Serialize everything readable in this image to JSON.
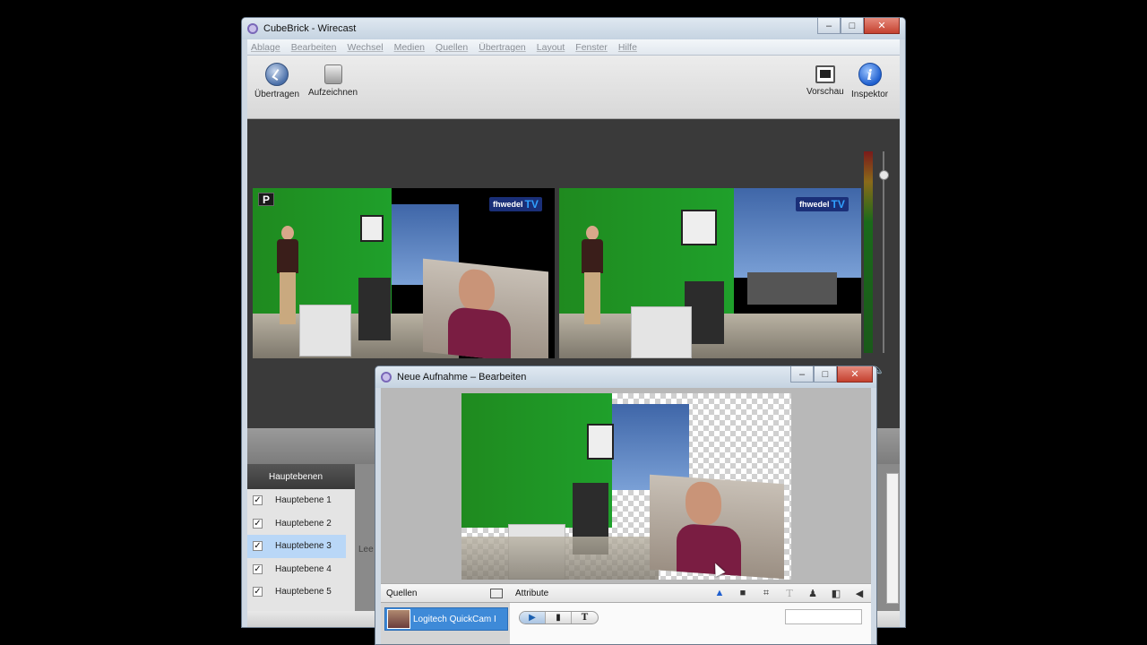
{
  "main_window": {
    "title": "CubeBrick - Wirecast",
    "window_buttons": {
      "minimize": "‒",
      "maximize": "□",
      "close": "✕"
    },
    "menu": [
      "Ablage",
      "Bearbeiten",
      "Wechsel",
      "Medien",
      "Quellen",
      "Übertragen",
      "Layout",
      "Fenster",
      "Hilfe"
    ],
    "toolbar": {
      "transmit_label": "Übertragen",
      "record_label": "Aufzeichnen",
      "preview_label": "Vorschau",
      "inspector_label": "Inspektor",
      "inspector_glyph": "i"
    },
    "preview": {
      "badge": "P",
      "logo_text": "fhwedel",
      "logo_tv": "TV"
    },
    "live": {
      "logo_text": "fhwedel",
      "logo_tv": "TV"
    },
    "layers": {
      "header": "Hauptebenen",
      "items": [
        {
          "label": "Hauptebene 1",
          "checked": true,
          "selected": false
        },
        {
          "label": "Hauptebene 2",
          "checked": true,
          "selected": false
        },
        {
          "label": "Hauptebene 3",
          "checked": true,
          "selected": true
        },
        {
          "label": "Hauptebene 4",
          "checked": true,
          "selected": false
        },
        {
          "label": "Hauptebene 5",
          "checked": true,
          "selected": false
        }
      ]
    },
    "partial_text": "Lee"
  },
  "dialog": {
    "title": "Neue Aufnahme – Bearbeiten",
    "sources_header": "Quellen",
    "attributes_header": "Attribute",
    "source_item": "Logitech QuickCam I",
    "segment_buttons": {
      "camera": "▶",
      "document": "▮",
      "text": "T"
    }
  },
  "colors": {
    "selection": "#b9d7f7",
    "source_selected": "#3e8ad8",
    "accent": "#1f5fcf"
  }
}
